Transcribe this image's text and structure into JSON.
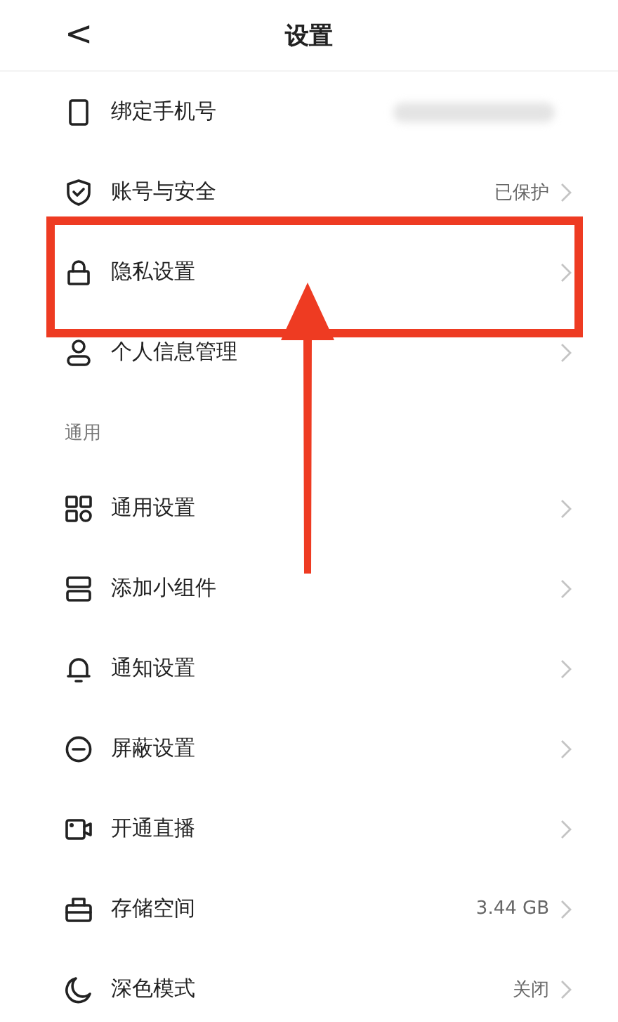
{
  "header": {
    "back": "<",
    "title": "设置"
  },
  "sections": [
    {
      "rows": [
        {
          "kind": "hidden",
          "label": "绑定手机号",
          "highlighted": false
        },
        {
          "kind": "link",
          "label": "账号与安全",
          "value": "已保护",
          "highlighted": false
        },
        {
          "kind": "link",
          "label": "隐私设置",
          "highlighted": true
        },
        {
          "kind": "link",
          "label": "个人信息管理",
          "highlighted": false
        }
      ]
    },
    {
      "title": "通用",
      "rows": [
        {
          "kind": "link",
          "label": "通用设置",
          "highlighted": false
        },
        {
          "kind": "link",
          "label": "添加小组件",
          "highlighted": false
        },
        {
          "kind": "link",
          "label": "通知设置",
          "highlighted": false
        },
        {
          "kind": "link",
          "label": "屏蔽设置",
          "highlighted": false
        },
        {
          "kind": "link",
          "label": "开通直播",
          "highlighted": false
        },
        {
          "kind": "link",
          "label": "存储空间",
          "value": "3.44 GB",
          "highlighted": false
        },
        {
          "kind": "link",
          "label": "深色模式",
          "value": "关闭",
          "highlighted": false
        }
      ]
    }
  ]
}
